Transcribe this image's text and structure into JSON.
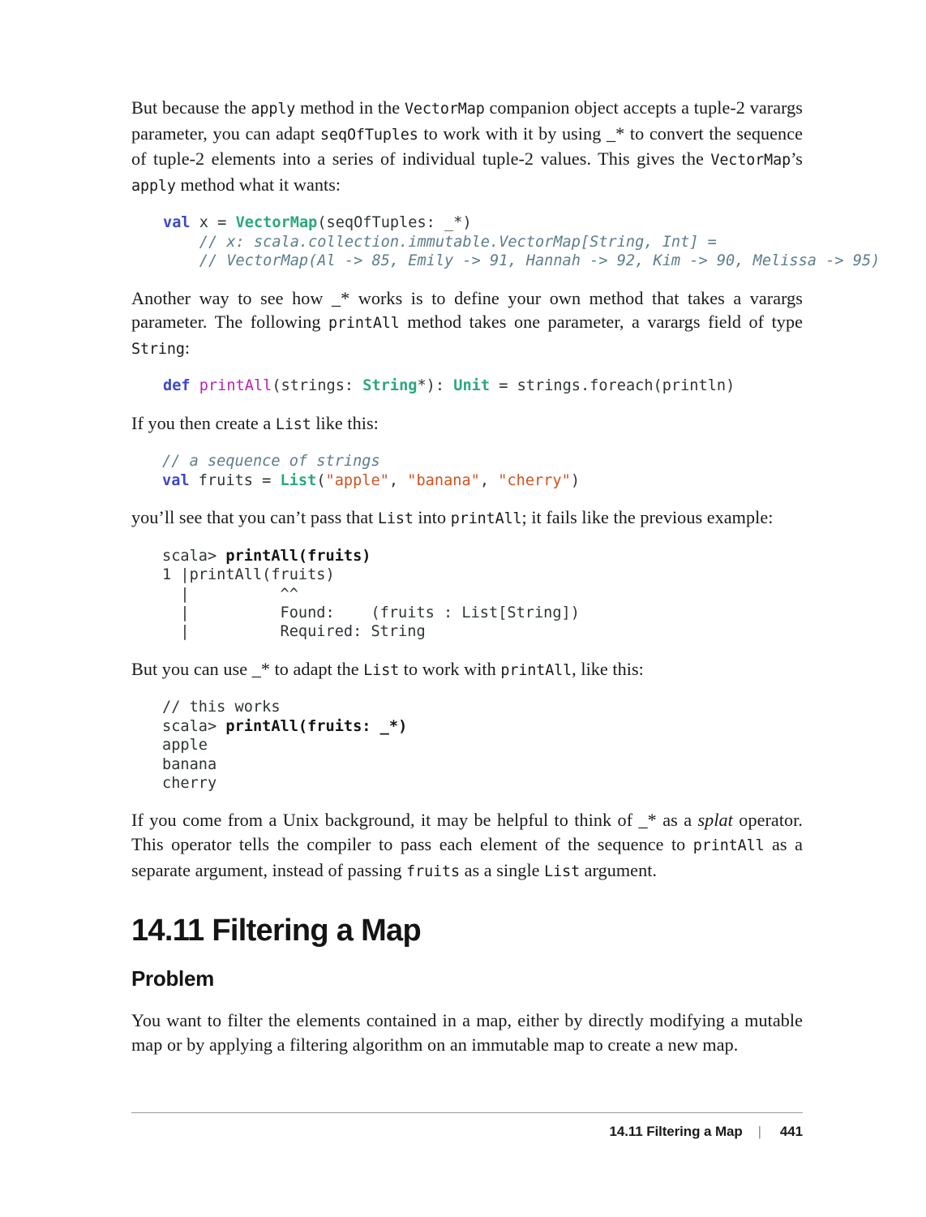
{
  "page": {
    "number": "441",
    "footer_title": "14.11 Filtering a Map",
    "footer_separator": "|"
  },
  "paragraphs": {
    "p1_a": "But because the ",
    "p1_c1": "apply",
    "p1_b": " method in the ",
    "p1_c2": "VectorMap",
    "p1_c": " companion object accepts a tuple-2 varargs parameter, you can adapt ",
    "p1_c3": "seqOfTuples",
    "p1_d": " to work with it by using _* to convert the sequence of tuple-2 elements into a series of individual tuple-2 values. This gives the ",
    "p1_c4": "VectorMap",
    "p1_e": "’s ",
    "p1_c5": "apply",
    "p1_f": " method what it wants:",
    "p2_a": "Another way to see how _* works is to define your own method that takes a varargs parameter. The following ",
    "p2_c1": "printAll",
    "p2_b": " method takes one parameter, a varargs field of type ",
    "p2_c2": "String",
    "p2_c": ":",
    "p3_a": "If you then create a ",
    "p3_c1": "List",
    "p3_b": " like this:",
    "p4_a": "you’ll see that you can’t pass that ",
    "p4_c1": "List",
    "p4_b": " into ",
    "p4_c2": "printAll",
    "p4_c": "; it fails like the previous example:",
    "p5_a": "But you can use _* to adapt the ",
    "p5_c1": "List",
    "p5_b": " to work with ",
    "p5_c2": "printAll",
    "p5_c": ", like this:",
    "p6_a": "If you come from a Unix background, it may be helpful to think of _* as a ",
    "p6_i1": "splat",
    "p6_b": " operator. This operator tells the compiler to pass each element of the sequence to ",
    "p6_c1": "printAll",
    "p6_c": " as a separate argument, instead of passing ",
    "p6_c2": "fruits",
    "p6_d": " as a single ",
    "p6_c3": "List",
    "p6_e": " argument.",
    "p7": "You want to filter the elements contained in a map, either by directly modifying a mutable map or by applying a filtering algorithm on an immutable map to create a new map."
  },
  "headings": {
    "section": "14.11 Filtering a Map",
    "subsection": "Problem"
  },
  "code_blocks": {
    "block1": {
      "line1_kw": "val",
      "line1_var": " x = ",
      "line1_type": "VectorMap",
      "line1_rest": "(seqOfTuples: _*)",
      "line2": "    // x: scala.collection.immutable.VectorMap[String, Int] =",
      "line3": "    // VectorMap(Al -> 85, Emily -> 91, Hannah -> 92, Kim -> 90, Melissa -> 95)"
    },
    "block2": {
      "kw": "def",
      "fn": " printAll",
      "p1": "(strings: ",
      "t1": "String",
      "p2": "*): ",
      "t2": "Unit",
      "p3": " = strings.foreach(println)"
    },
    "block3": {
      "comment": "// a sequence of strings",
      "kw": "val",
      "var": " fruits = ",
      "type": "List",
      "open": "(",
      "s1": "\"apple\"",
      "sep1": ", ",
      "s2": "\"banana\"",
      "sep2": ", ",
      "s3": "\"cherry\"",
      "close": ")"
    },
    "block4": {
      "prompt": "scala> ",
      "cmd": "printAll(fruits)",
      "line2": "1 |printAll(fruits)",
      "line3": "  |          ^^",
      "line4": "  |          Found:    (fruits : List[String])",
      "line5": "  |          Required: String"
    },
    "block5": {
      "comment": "// this works",
      "prompt": "scala> ",
      "cmd": "printAll(fruits: _*)",
      "out1": "apple",
      "out2": "banana",
      "out3": "cherry"
    }
  },
  "colors": {
    "keyword": "#3b49c8",
    "type": "#2aa87a",
    "function": "#b724b0",
    "string": "#d1511f",
    "comment": "#5c7c8a",
    "text": "#1a1a1a",
    "rule": "#9a9a9a"
  }
}
